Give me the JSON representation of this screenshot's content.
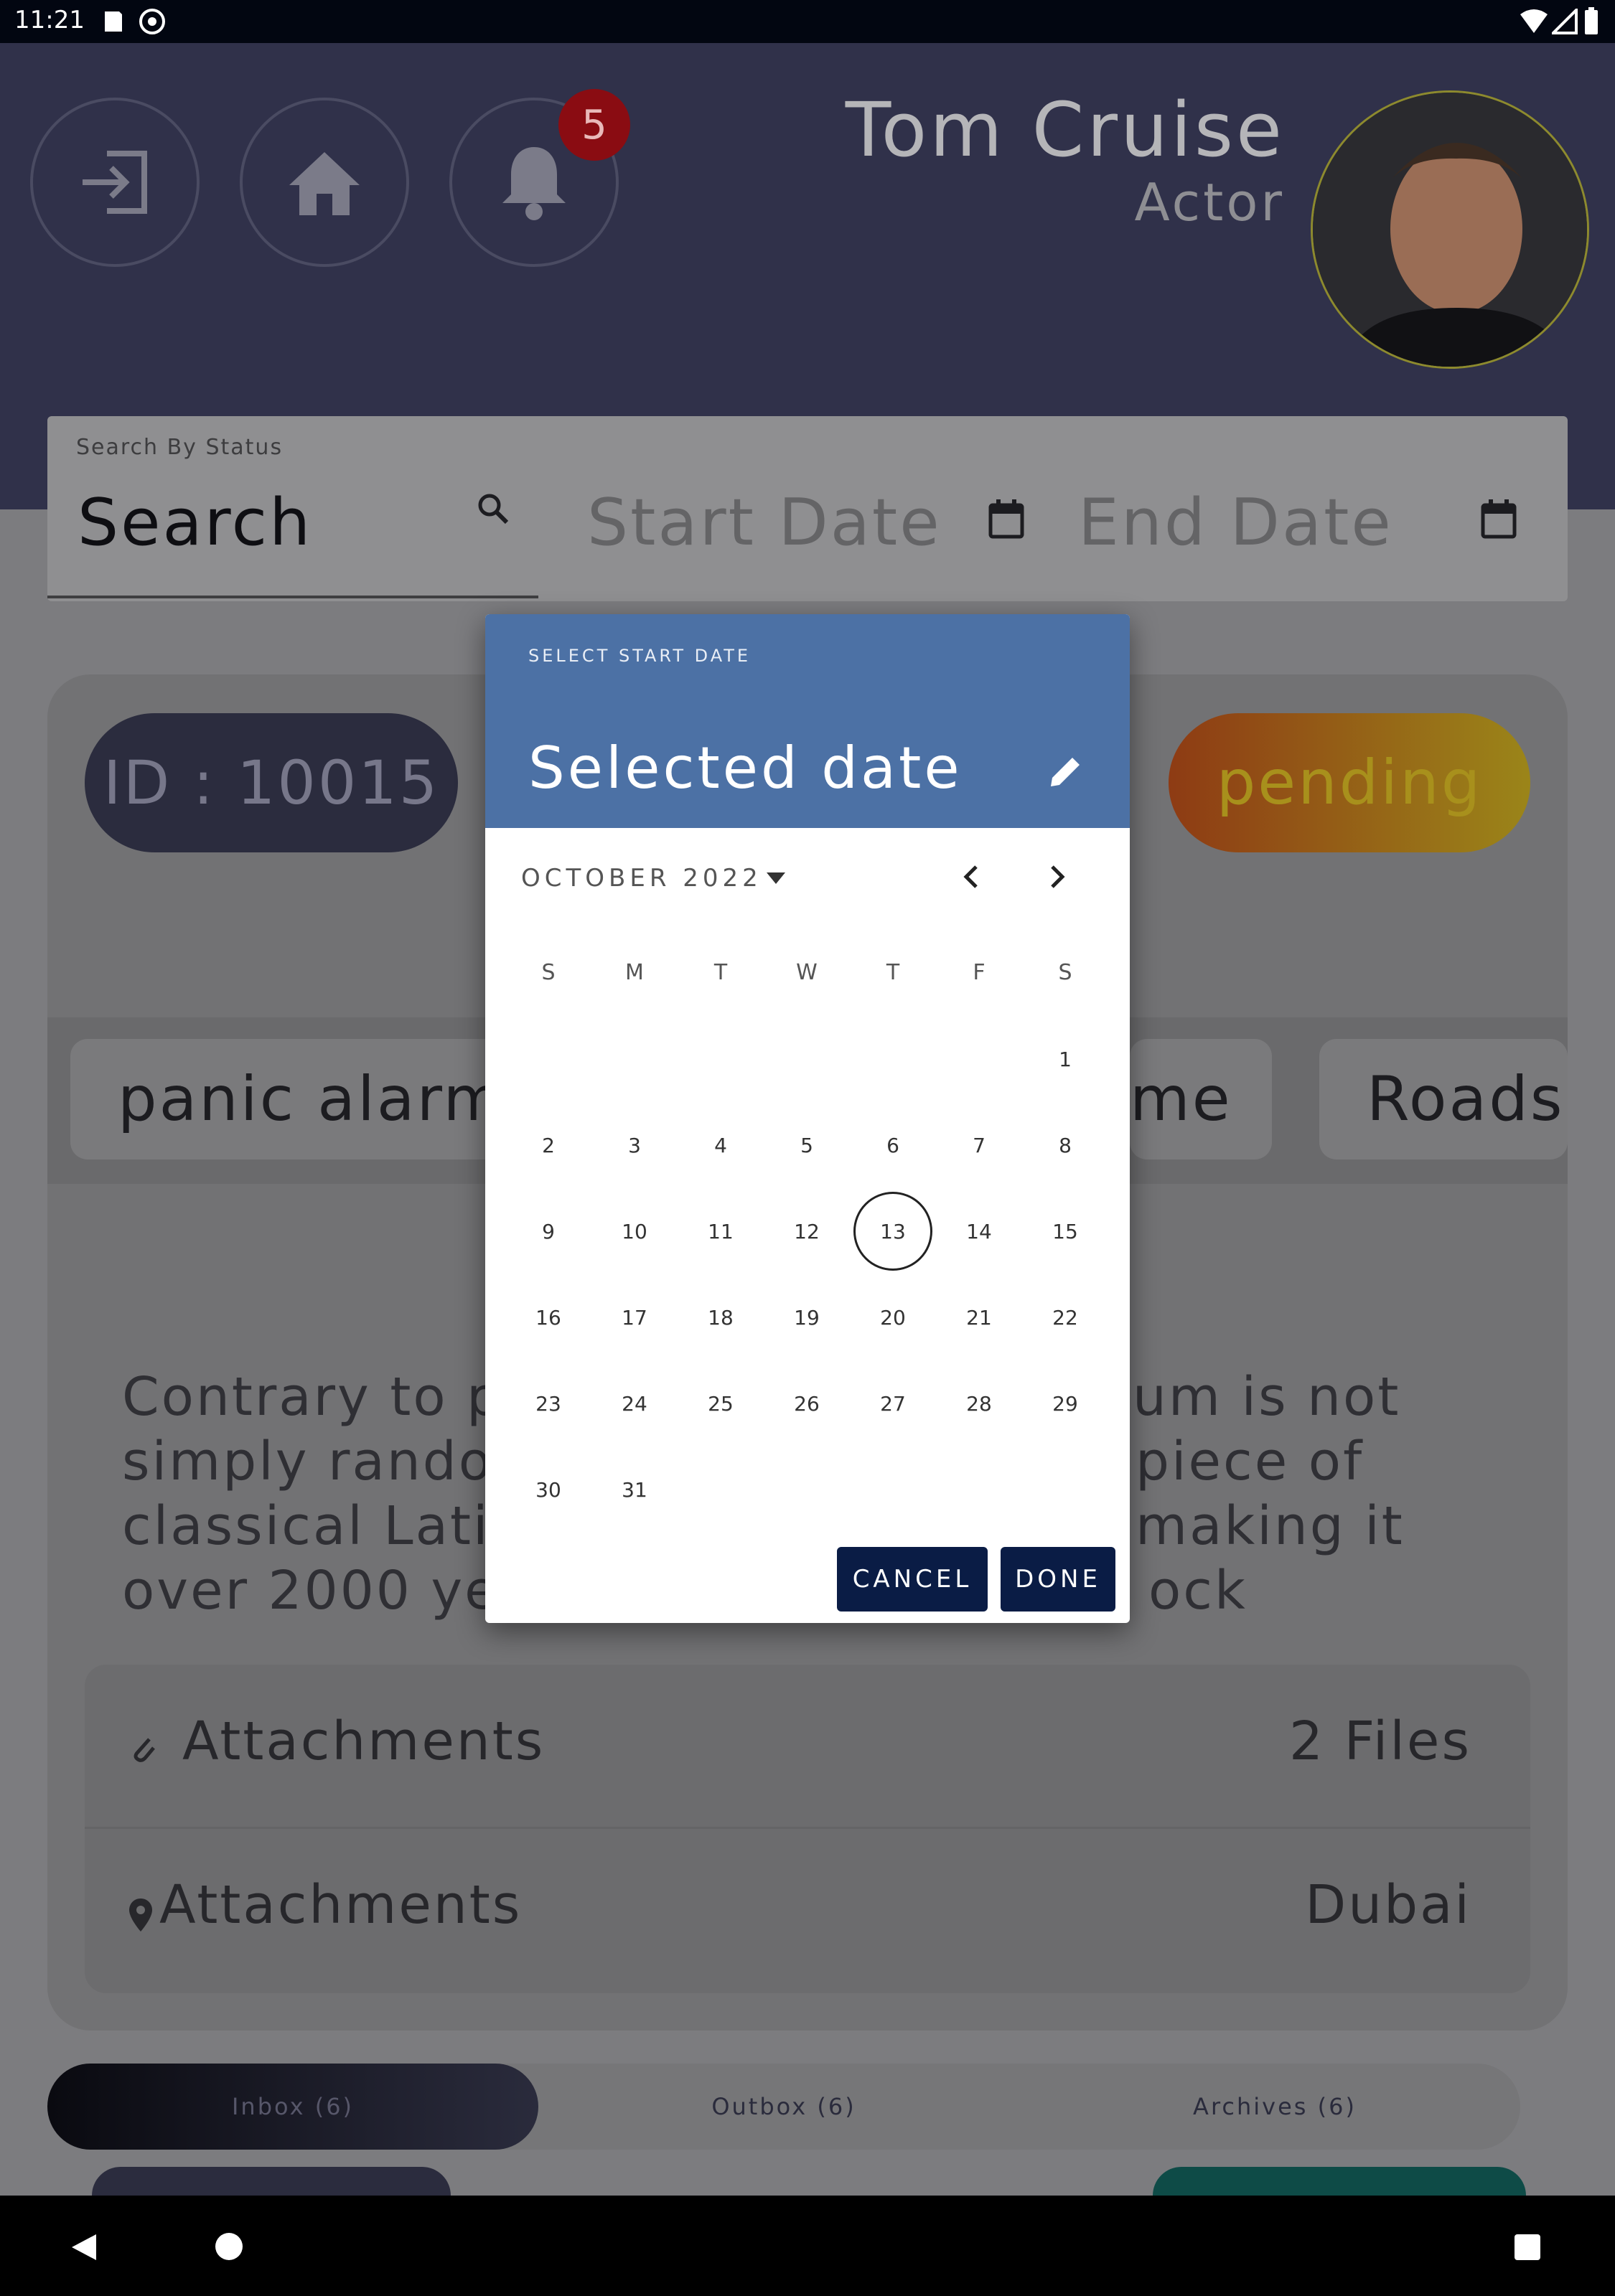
{
  "status_bar": {
    "time": "11:21"
  },
  "header": {
    "notification_count": "5",
    "user_name": "Tom Cruise",
    "user_role": "Actor"
  },
  "search": {
    "label": "Search By Status",
    "value": "Search",
    "start_date_placeholder": "Start Date",
    "end_date_placeholder": "End Date"
  },
  "ticket": {
    "id": "ID : 10015",
    "status": "pending",
    "tags": [
      "panic alarm",
      "me",
      "Roads"
    ],
    "body_left_lines": [
      "Contrary to p",
      "simply rando",
      "classical Latin",
      "over 2000 ye"
    ],
    "body_right_lines": [
      "um is not",
      "piece of",
      "making it",
      "ock"
    ],
    "attachments": [
      {
        "label": "Attachments",
        "value": "2 Files",
        "icon": "paperclip-icon"
      },
      {
        "label": "Attachments",
        "value": "Dubai",
        "icon": "location-pin-icon"
      }
    ]
  },
  "tabs": [
    "Inbox (6)",
    "Outbox (6)",
    "Archives (6)"
  ],
  "active_tab": "Inbox (6)",
  "date_picker": {
    "subtitle": "SELECT START DATE",
    "title": "Selected date",
    "month_year": "OCTOBER 2022",
    "weekdays": [
      "S",
      "M",
      "T",
      "W",
      "T",
      "F",
      "S"
    ],
    "first_weekday_index": 6,
    "days_in_month": 31,
    "today": "13",
    "cancel_label": "CANCEL",
    "done_label": "DONE"
  },
  "colors": {
    "header_bg": "#30314a",
    "dialog_header": "#4c71a5",
    "dialog_button": "#0a1c45",
    "badge": "#8a0c12"
  }
}
